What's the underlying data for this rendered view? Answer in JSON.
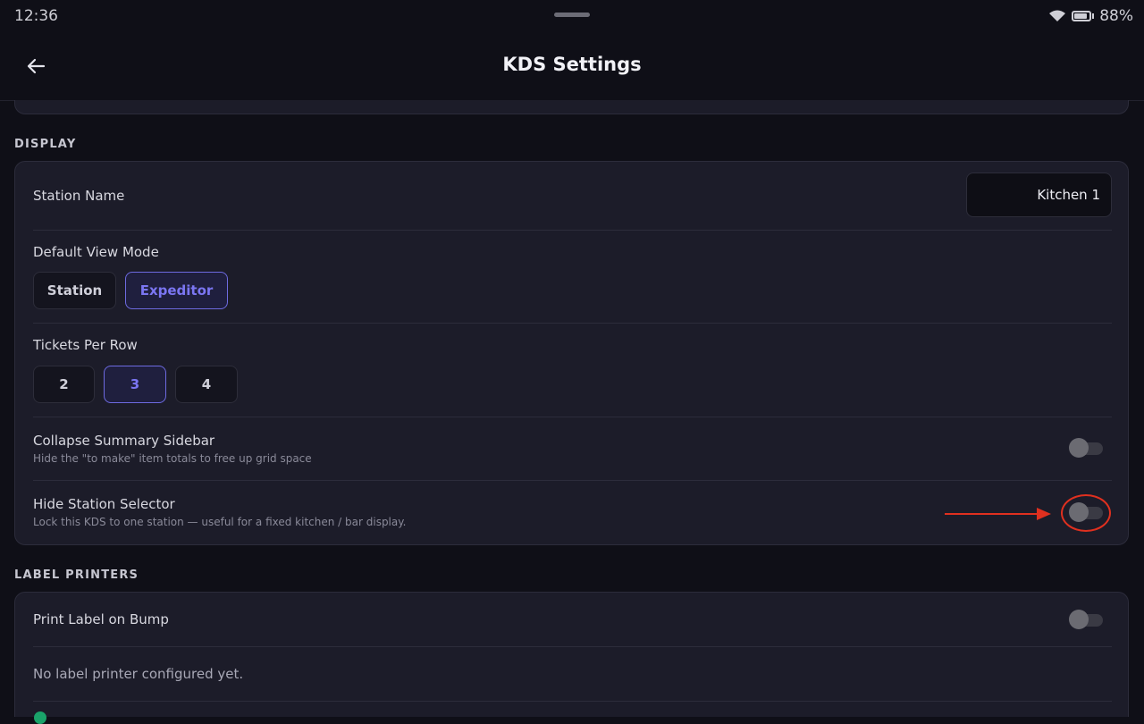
{
  "status_bar": {
    "time": "12:36",
    "battery": "88%"
  },
  "header": {
    "title": "KDS Settings",
    "back_icon": "arrow-left-icon"
  },
  "display": {
    "section_label": "DISPLAY",
    "station_name": {
      "label": "Station Name",
      "value": "Kitchen 1"
    },
    "default_view_mode": {
      "label": "Default View Mode",
      "options": [
        "Station",
        "Expeditor"
      ],
      "selected": "Expeditor"
    },
    "tickets_per_row": {
      "label": "Tickets Per Row",
      "options": [
        "2",
        "3",
        "4"
      ],
      "selected": "3"
    },
    "collapse_summary_sidebar": {
      "label": "Collapse Summary Sidebar",
      "description": "Hide the \"to make\" item totals to free up grid space",
      "enabled": false
    },
    "hide_station_selector": {
      "label": "Hide Station Selector",
      "description": "Lock this KDS to one station — useful for a fixed kitchen / bar display.",
      "enabled": false
    }
  },
  "label_printers": {
    "section_label": "LABEL PRINTERS",
    "print_label_on_bump": {
      "label": "Print Label on Bump",
      "enabled": false
    },
    "empty_message": "No label printer configured yet."
  },
  "colors": {
    "accent": "#6d6ae0",
    "annotation": "#e0301f",
    "background": "#0f0f17",
    "card": "#1c1c29"
  }
}
